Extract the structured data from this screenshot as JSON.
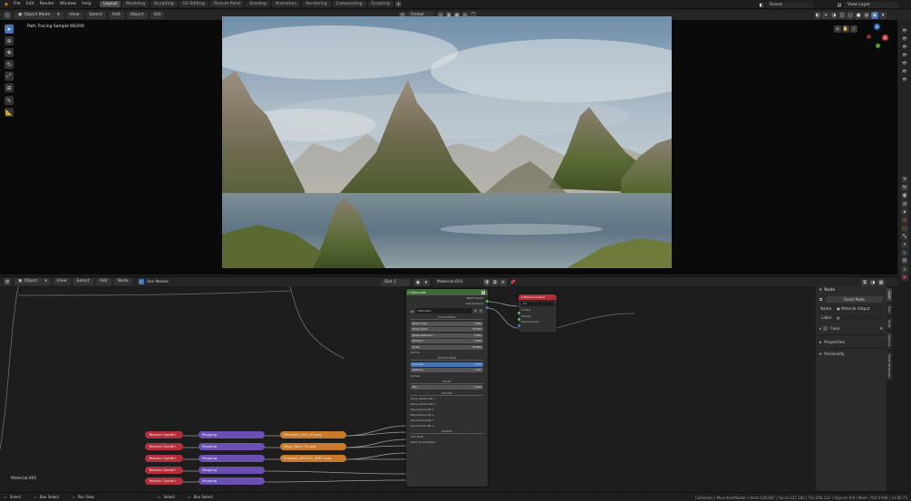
{
  "topbar": {
    "menus": [
      "File",
      "Edit",
      "Render",
      "Window",
      "Help"
    ],
    "workspaces": [
      "Layout",
      "Modeling",
      "Sculpting",
      "UV Editing",
      "Texture Paint",
      "Shading",
      "Animation",
      "Rendering",
      "Compositing",
      "Scripting"
    ],
    "active_workspace": "Layout",
    "add_tab": "+",
    "scene": "Scene",
    "view_layer": "View Layer"
  },
  "viewport_header": {
    "mode": "Object Mode",
    "menus": [
      "View",
      "Select",
      "Add",
      "Object",
      "GIS"
    ],
    "orientation": "Global"
  },
  "viewport": {
    "render_status": "Path Tracing Sample 66/200"
  },
  "node_header": {
    "editor_type": "Object",
    "menus": [
      "View",
      "Select",
      "Add",
      "Node"
    ],
    "use_nodes_label": "Use Nodes",
    "slot": "Slot 1",
    "material": "Material.001"
  },
  "mountain_node": {
    "title": "Mountain",
    "outputs": [
      "BSDF Shader",
      "Displacement"
    ],
    "object": "Mountain",
    "sections": {
      "displacement": "DISPLACEMENT",
      "texture_bump": "TEXTURE BUMP",
      "mixing": "MIXING",
      "texture": "TEXTURE",
      "mapping": "MAPPING"
    },
    "displacement_fields": [
      {
        "label": "Noise Scale",
        "value": "2.980"
      },
      {
        "label": "Noise Detail",
        "value": "16.000"
      },
      {
        "label": "Noise Distortion",
        "value": "2.000"
      },
      {
        "label": "Midlevel",
        "value": "0.500"
      },
      {
        "label": "Scale",
        "value": "38.900"
      }
    ],
    "normal_label": "Normal",
    "bump_fields": [
      {
        "label": "Strength",
        "value": "1.000"
      },
      {
        "label": "Distance",
        "value": "1.000"
      }
    ],
    "normal_label_2": "Normal",
    "mix_field": {
      "label": "Mix",
      "value": "1.000"
    },
    "texture_inputs": [
      "Rocky Texture Mk 1",
      "Rocky Texture Mk 2",
      "Moss Texture Mk 1",
      "Moss Texture Mk 2",
      "Sand Texture Mk 1",
      "Sand Texture Mk 2"
    ],
    "mapping_inputs": [
      "UVC Node",
      "World Grow Mapper"
    ]
  },
  "output_node": {
    "title": "Material Output",
    "target": "All",
    "inputs": [
      "Surface",
      "Volume",
      "Displacement"
    ]
  },
  "texture_nodes": [
    {
      "coord": "Texture Coordin",
      "mapping": "Mapping",
      "image": "Mountain_Grit_01.png"
    },
    {
      "coord": "Texture Coordin",
      "mapping": "Mapping",
      "image": "Moss_Rock_01.png"
    },
    {
      "coord": "Texture Coordin",
      "mapping": "Mapping",
      "image": "Sunlight_SPEC01_SPEC.png"
    },
    {
      "coord": "Texture Coordin",
      "mapping": "Mapping",
      "image": ""
    },
    {
      "coord": "Texture Coordin",
      "mapping": "Mapping",
      "image": ""
    }
  ],
  "node_editor_label": "Material.001",
  "sidebar": {
    "section": "Node",
    "reset_button": "Reset Node",
    "name_label": "Name",
    "name_value": "Material Output",
    "label_label": "Label",
    "label_value": "",
    "color_label": "Color",
    "properties_label": "Properties",
    "reclassify_label": "Reclassify",
    "tabs": [
      "Node",
      "Tool",
      "View",
      "Options",
      "Node Wrangler"
    ]
  },
  "statusbar": {
    "items": [
      "Select",
      "Box Select",
      "Pan View",
      "Select",
      "Box Select"
    ],
    "stats": "Collection | MountainMaster | Verts:139,687 | Faces:137,180 | Tris:256,122 | Objects:0/4 | Mem: 756.9 MiB | v2.80.75"
  },
  "colors": {
    "accent": "#4772b3",
    "node_red": "#b32f3b",
    "node_purple": "#6c4fb3",
    "node_orange": "#c87a2a",
    "node_green": "#3c6b35"
  }
}
